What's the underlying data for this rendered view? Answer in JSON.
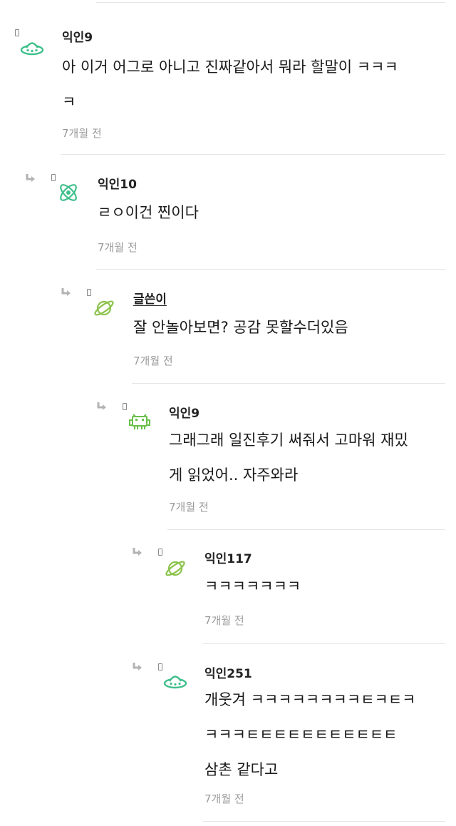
{
  "comments": [
    {
      "author": "익인9",
      "avatar_icon": "ufo-icon",
      "lines": [
        "아 이거 어그로 아니고 진짜같아서 뭐라 할말이 ㅋㅋㅋ",
        "ㅋ"
      ],
      "time": "7개월 전"
    },
    {
      "author": "익인10",
      "avatar_icon": "atom-icon",
      "lines": [
        "ㄹㅇ이건 찐이다"
      ],
      "time": "7개월 전"
    },
    {
      "author": "글쓴이",
      "avatar_icon": "planet-icon",
      "lines": [
        "잘 안놀아보면? 공감 못할수더있음"
      ],
      "time": "7개월 전"
    },
    {
      "author": "익인9",
      "avatar_icon": "space-invader-icon",
      "lines": [
        "그래그래 일진후기 써줘서 고마워 재밌",
        "게 읽었어.. 자주와라"
      ],
      "time": "7개월 전"
    },
    {
      "author": "익인117",
      "avatar_icon": "planet-icon",
      "lines": [
        "ㅋㅋㅋㅋㅋㅋㅋ"
      ],
      "time": "7개월 전"
    },
    {
      "author": "익인251",
      "avatar_icon": "ufo-icon",
      "lines": [
        "개웃겨 ㅋㅋㅋㅋㅋㅋㅋㅋㅌㅋㅌㅋ",
        "ㅋㅋㅋㅌㅌㅌㅌㅌㅌㅌㅌㅌㅌㅌ",
        "삼촌 같다고"
      ],
      "time": "7개월 전"
    }
  ],
  "colors": {
    "avatar_green": "#3fbf8a",
    "planet_green": "#8bc34a",
    "invader_green": "#6abf4b"
  }
}
